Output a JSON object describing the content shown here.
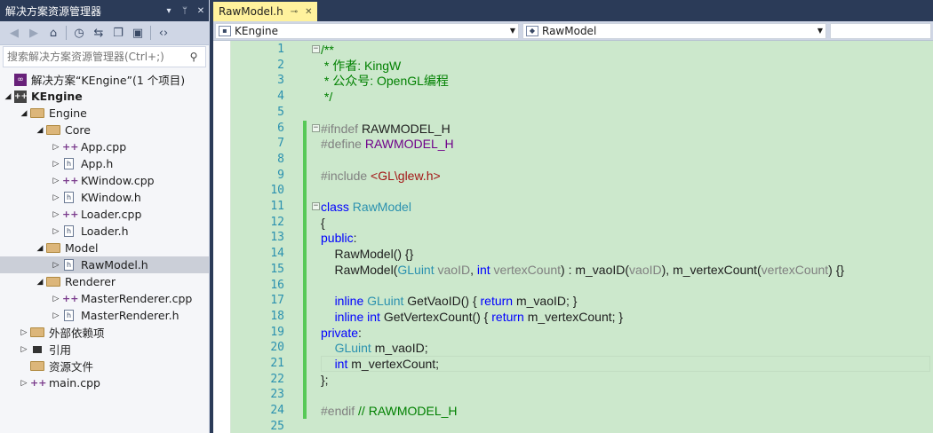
{
  "solution_explorer": {
    "title": "解决方案资源管理器",
    "title_buttons": [
      "▾",
      "ᛘ",
      "✕"
    ],
    "search_placeholder": "搜索解决方案资源管理器(Ctrl+;)",
    "tree": [
      {
        "label": "解决方案“KEngine”(1 个项目)",
        "depth": 0,
        "kind": "sol",
        "arrow": ""
      },
      {
        "label": "KEngine",
        "depth": 0,
        "kind": "proj",
        "arrow": "◢",
        "bold": true
      },
      {
        "label": "Engine",
        "depth": 1,
        "kind": "folder",
        "arrow": "◢"
      },
      {
        "label": "Core",
        "depth": 2,
        "kind": "folder",
        "arrow": "◢"
      },
      {
        "label": "App.cpp",
        "depth": 3,
        "kind": "cpp",
        "arrow": "▷"
      },
      {
        "label": "App.h",
        "depth": 3,
        "kind": "h",
        "arrow": "▷"
      },
      {
        "label": "KWindow.cpp",
        "depth": 3,
        "kind": "cpp",
        "arrow": "▷"
      },
      {
        "label": "KWindow.h",
        "depth": 3,
        "kind": "h",
        "arrow": "▷"
      },
      {
        "label": "Loader.cpp",
        "depth": 3,
        "kind": "cpp",
        "arrow": "▷"
      },
      {
        "label": "Loader.h",
        "depth": 3,
        "kind": "h",
        "arrow": "▷"
      },
      {
        "label": "Model",
        "depth": 2,
        "kind": "folder",
        "arrow": "◢"
      },
      {
        "label": "RawModel.h",
        "depth": 3,
        "kind": "h",
        "arrow": "▷",
        "selected": true
      },
      {
        "label": "Renderer",
        "depth": 2,
        "kind": "folder",
        "arrow": "◢"
      },
      {
        "label": "MasterRenderer.cpp",
        "depth": 3,
        "kind": "cpp",
        "arrow": "▷"
      },
      {
        "label": "MasterRenderer.h",
        "depth": 3,
        "kind": "h",
        "arrow": "▷"
      },
      {
        "label": "外部依赖项",
        "depth": 1,
        "kind": "folder",
        "arrow": "▷"
      },
      {
        "label": "引用",
        "depth": 1,
        "kind": "ref",
        "arrow": "▷"
      },
      {
        "label": "资源文件",
        "depth": 1,
        "kind": "folder",
        "arrow": ""
      },
      {
        "label": "main.cpp",
        "depth": 1,
        "kind": "cpp",
        "arrow": "▷"
      }
    ]
  },
  "editor": {
    "tab_title": "RawModel.h",
    "tab_pin": "⊸",
    "tab_close": "✕",
    "scope_dropdown": "KEngine",
    "member_dropdown": "RawModel",
    "lines": [
      {
        "n": "1",
        "fold": "−",
        "segs": [
          {
            "t": "/**",
            "c": "com"
          }
        ]
      },
      {
        "n": "2",
        "segs": [
          {
            "t": " * 作者: KingW",
            "c": "com"
          }
        ]
      },
      {
        "n": "3",
        "segs": [
          {
            "t": " * 公众号: OpenGL编程",
            "c": "com"
          }
        ]
      },
      {
        "n": "4",
        "segs": [
          {
            "t": " */",
            "c": "com"
          }
        ]
      },
      {
        "n": "5",
        "segs": []
      },
      {
        "n": "6",
        "fold": "−",
        "chg": true,
        "segs": [
          {
            "t": "#ifndef ",
            "c": "pp"
          },
          {
            "t": "RAWMODEL_H",
            "c": ""
          }
        ]
      },
      {
        "n": "7",
        "chg": true,
        "segs": [
          {
            "t": "#define ",
            "c": "pp"
          },
          {
            "t": "RAWMODEL_H",
            "c": "mac"
          }
        ]
      },
      {
        "n": "8",
        "chg": true,
        "segs": []
      },
      {
        "n": "9",
        "chg": true,
        "segs": [
          {
            "t": "#include ",
            "c": "pp"
          },
          {
            "t": "<GL\\glew.h>",
            "c": "str"
          }
        ]
      },
      {
        "n": "10",
        "chg": true,
        "segs": []
      },
      {
        "n": "11",
        "fold": "−",
        "chg": true,
        "segs": [
          {
            "t": "class ",
            "c": "kw"
          },
          {
            "t": "RawModel",
            "c": "type"
          }
        ]
      },
      {
        "n": "12",
        "chg": true,
        "segs": [
          {
            "t": "{",
            "c": ""
          }
        ]
      },
      {
        "n": "13",
        "chg": true,
        "segs": [
          {
            "t": "public",
            "c": "kw"
          },
          {
            "t": ":",
            "c": ""
          }
        ]
      },
      {
        "n": "14",
        "chg": true,
        "segs": [
          {
            "t": "    RawModel() {}",
            "c": ""
          }
        ]
      },
      {
        "n": "15",
        "chg": true,
        "segs": [
          {
            "t": "    RawModel(",
            "c": ""
          },
          {
            "t": "GLuint",
            "c": "type"
          },
          {
            "t": " ",
            "c": ""
          },
          {
            "t": "vaoID",
            "c": "par"
          },
          {
            "t": ", ",
            "c": ""
          },
          {
            "t": "int",
            "c": "kw"
          },
          {
            "t": " ",
            "c": ""
          },
          {
            "t": "vertexCount",
            "c": "par"
          },
          {
            "t": ") : m_vaoID(",
            "c": ""
          },
          {
            "t": "vaoID",
            "c": "par"
          },
          {
            "t": "), m_vertexCount(",
            "c": ""
          },
          {
            "t": "vertexCount",
            "c": "par"
          },
          {
            "t": ") {}",
            "c": ""
          }
        ]
      },
      {
        "n": "16",
        "chg": true,
        "segs": []
      },
      {
        "n": "17",
        "chg": true,
        "segs": [
          {
            "t": "    ",
            "c": ""
          },
          {
            "t": "inline",
            "c": "kw"
          },
          {
            "t": " ",
            "c": ""
          },
          {
            "t": "GLuint",
            "c": "type"
          },
          {
            "t": " GetVaoID() { ",
            "c": ""
          },
          {
            "t": "return",
            "c": "kw"
          },
          {
            "t": " m_vaoID; }",
            "c": ""
          }
        ]
      },
      {
        "n": "18",
        "chg": true,
        "segs": [
          {
            "t": "    ",
            "c": ""
          },
          {
            "t": "inline",
            "c": "kw"
          },
          {
            "t": " ",
            "c": ""
          },
          {
            "t": "int",
            "c": "kw"
          },
          {
            "t": " GetVertexCount() { ",
            "c": ""
          },
          {
            "t": "return",
            "c": "kw"
          },
          {
            "t": " m_vertexCount; }",
            "c": ""
          }
        ]
      },
      {
        "n": "19",
        "chg": true,
        "segs": [
          {
            "t": "private",
            "c": "kw"
          },
          {
            "t": ":",
            "c": ""
          }
        ]
      },
      {
        "n": "20",
        "chg": true,
        "segs": [
          {
            "t": "    ",
            "c": ""
          },
          {
            "t": "GLuint",
            "c": "type"
          },
          {
            "t": " m_vaoID;",
            "c": ""
          }
        ]
      },
      {
        "n": "21",
        "chg": true,
        "cur": true,
        "segs": [
          {
            "t": "    ",
            "c": ""
          },
          {
            "t": "int",
            "c": "kw"
          },
          {
            "t": " m_vertexCount;",
            "c": ""
          }
        ]
      },
      {
        "n": "22",
        "chg": true,
        "segs": [
          {
            "t": "};",
            "c": ""
          }
        ]
      },
      {
        "n": "23",
        "chg": true,
        "segs": []
      },
      {
        "n": "24",
        "chg": true,
        "segs": [
          {
            "t": "#endif",
            "c": "pp"
          },
          {
            "t": " // RAWMODEL_H",
            "c": "com"
          }
        ]
      },
      {
        "n": "25",
        "segs": []
      }
    ]
  },
  "colors": {
    "editor_bg": "#cce8cc",
    "chrome": "#2b3b58",
    "tab_active": "#fff29d",
    "change_bar": "#57c957"
  }
}
